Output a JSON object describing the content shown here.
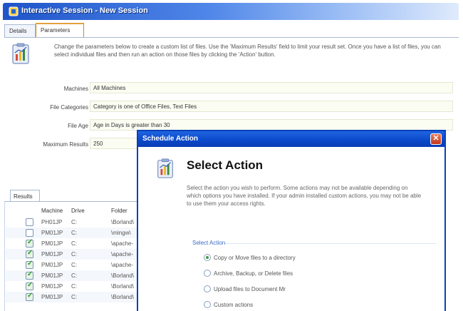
{
  "window": {
    "title": "Interactive Session - New Session"
  },
  "tabs": [
    {
      "label": "Details"
    },
    {
      "label": "Parameters"
    }
  ],
  "intro_text": "Change the parameters below to create a custom list of files. Use the 'Maximum Results' field to limit your result set. Once you have a list of files, you can select individual files and then run an action on those files by clicking the 'Action' button.",
  "fields": {
    "machines": {
      "label": "Machines",
      "value": "All Machines"
    },
    "file_categories": {
      "label": "File Categories",
      "value": "Category is one of Office Files, Text Files"
    },
    "file_age": {
      "label": "File Age",
      "value": "Age in Days is greater than 30"
    },
    "max_results": {
      "label": "Maximum Results",
      "value": "250"
    }
  },
  "results": {
    "tab_label": "Results",
    "headers": {
      "machine": "Machine",
      "drive": "Drive",
      "folder": "Folder"
    },
    "rows": [
      {
        "checked": false,
        "machine": "PH01JP",
        "drive": "C:",
        "folder": "\\Borland\\"
      },
      {
        "checked": false,
        "machine": "PM01JP",
        "drive": "C:",
        "folder": "\\mingw\\"
      },
      {
        "checked": true,
        "machine": "PM01JP",
        "drive": "C:",
        "folder": "\\apache-"
      },
      {
        "checked": true,
        "machine": "PM01JP",
        "drive": "C:",
        "folder": "\\apache-"
      },
      {
        "checked": true,
        "machine": "PM01JP",
        "drive": "C:",
        "folder": "\\apache-"
      },
      {
        "checked": true,
        "machine": "PM01JP",
        "drive": "C:",
        "folder": "\\Borland\\"
      },
      {
        "checked": true,
        "machine": "PM01JP",
        "drive": "C:",
        "folder": "\\Borland\\"
      },
      {
        "checked": true,
        "machine": "PM01JP",
        "drive": "C:",
        "folder": "\\Borland\\"
      }
    ]
  },
  "dialog": {
    "title": "Schedule Action",
    "close_glyph": "✕",
    "heading": "Select Action",
    "description": "Select the action you wish to perform. Some actions may not be available depending on which options you have installed. If your admin installed custom actions, you may not be able to use them your access rights.",
    "select_label": "Select Action",
    "options": [
      {
        "label": "Copy or Move files to a directory",
        "selected": true
      },
      {
        "label": "Archive, Backup, or Delete files",
        "selected": false
      },
      {
        "label": "Upload files to Document Mr",
        "selected": false
      },
      {
        "label": "Custom actions",
        "selected": false
      }
    ]
  }
}
